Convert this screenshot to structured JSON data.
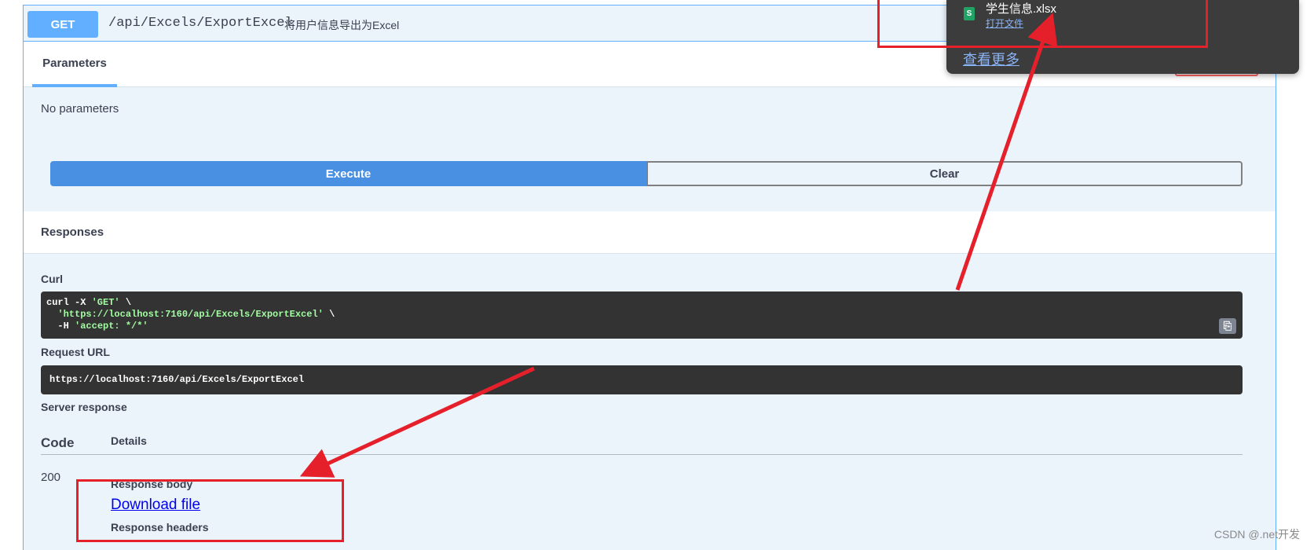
{
  "operation": {
    "method": "GET",
    "path": "/api/Excels/ExportExcel",
    "description": "将用户信息导出为Excel"
  },
  "parameters": {
    "tab_label": "Parameters",
    "empty_text": "No parameters"
  },
  "actions": {
    "execute_label": "Execute",
    "clear_label": "Clear"
  },
  "responses": {
    "title": "Responses",
    "curl_label": "Curl",
    "curl_lines": {
      "l1_prefix": "curl -X ",
      "l1_method": "'GET'",
      "l1_suffix": " \\",
      "l2_url": "'https://localhost:7160/api/Excels/ExportExcel'",
      "l2_suffix": " \\",
      "l3_prefix": "  -H ",
      "l3_header": "'accept: */*'"
    },
    "request_url_label": "Request URL",
    "request_url": "https://localhost:7160/api/Excels/ExportExcel",
    "server_response_label": "Server response",
    "col_code": "Code",
    "col_details": "Details",
    "code": "200",
    "response_body_label": "Response body",
    "download_link": "Download file",
    "response_headers_label": "Response headers"
  },
  "download_popup": {
    "file_name": "学生信息.xlsx",
    "open_file": "打开文件",
    "see_more": "查看更多",
    "file_icon_glyph": "S"
  },
  "watermark": "CSDN @.net开发",
  "colors": {
    "get_blue": "#61affe",
    "execute_blue": "#4990e2",
    "annotation_red": "#e5202b",
    "code_bg": "#333333"
  }
}
